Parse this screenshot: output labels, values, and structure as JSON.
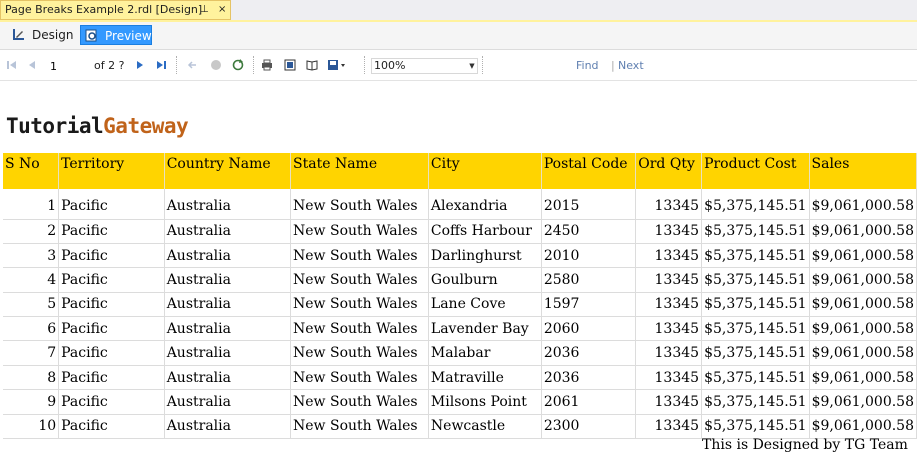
{
  "doc_tab": {
    "title": "Page Breaks Example 2.rdl [Design]",
    "pin": "⊥",
    "close": "×"
  },
  "mode_bar": {
    "design_label": "Design",
    "preview_label": "Preview"
  },
  "toolbar": {
    "page_value": "1",
    "of_text": "of  2 ?",
    "zoom_value": "100%",
    "find_label": "Find",
    "separator": "|",
    "next_label": "Next"
  },
  "report": {
    "logo_part1": "Tutorial",
    "logo_part2": "Gateway",
    "columns": [
      "S No",
      "Territory",
      "Country Name",
      "State Name",
      "City",
      "Postal Code",
      "Ord Qty",
      "Product Cost",
      "Sales"
    ],
    "rows": [
      [
        "1",
        "Pacific",
        "Australia",
        "New South Wales",
        "Alexandria",
        "2015",
        "13345",
        "$5,375,145.51",
        "$9,061,000.58"
      ],
      [
        "2",
        "Pacific",
        "Australia",
        "New South Wales",
        "Coffs Harbour",
        "2450",
        "13345",
        "$5,375,145.51",
        "$9,061,000.58"
      ],
      [
        "3",
        "Pacific",
        "Australia",
        "New South Wales",
        "Darlinghurst",
        "2010",
        "13345",
        "$5,375,145.51",
        "$9,061,000.58"
      ],
      [
        "4",
        "Pacific",
        "Australia",
        "New South Wales",
        "Goulburn",
        "2580",
        "13345",
        "$5,375,145.51",
        "$9,061,000.58"
      ],
      [
        "5",
        "Pacific",
        "Australia",
        "New South Wales",
        "Lane Cove",
        "1597",
        "13345",
        "$5,375,145.51",
        "$9,061,000.58"
      ],
      [
        "6",
        "Pacific",
        "Australia",
        "New South Wales",
        "Lavender Bay",
        "2060",
        "13345",
        "$5,375,145.51",
        "$9,061,000.58"
      ],
      [
        "7",
        "Pacific",
        "Australia",
        "New South Wales",
        "Malabar",
        "2036",
        "13345",
        "$5,375,145.51",
        "$9,061,000.58"
      ],
      [
        "8",
        "Pacific",
        "Australia",
        "New South Wales",
        "Matraville",
        "2036",
        "13345",
        "$5,375,145.51",
        "$9,061,000.58"
      ],
      [
        "9",
        "Pacific",
        "Australia",
        "New South Wales",
        "Milsons Point",
        "2061",
        "13345",
        "$5,375,145.51",
        "$9,061,000.58"
      ],
      [
        "10",
        "Pacific",
        "Australia",
        "New South Wales",
        "Newcastle",
        "2300",
        "13345",
        "$5,375,145.51",
        "$9,061,000.58"
      ]
    ],
    "footer": "This is Designed by TG Team"
  },
  "colors": {
    "header_fill": "#ffd400",
    "tab_fill": "#fff29d",
    "preview_active": "#3399ff",
    "logo_accent": "#c0631a"
  },
  "icons": [
    "first-page-icon",
    "prev-page-icon",
    "next-page-icon",
    "last-page-icon",
    "back-icon",
    "stop-icon",
    "refresh-icon",
    "print-icon",
    "print-layout-icon",
    "page-setup-icon",
    "export-icon"
  ]
}
